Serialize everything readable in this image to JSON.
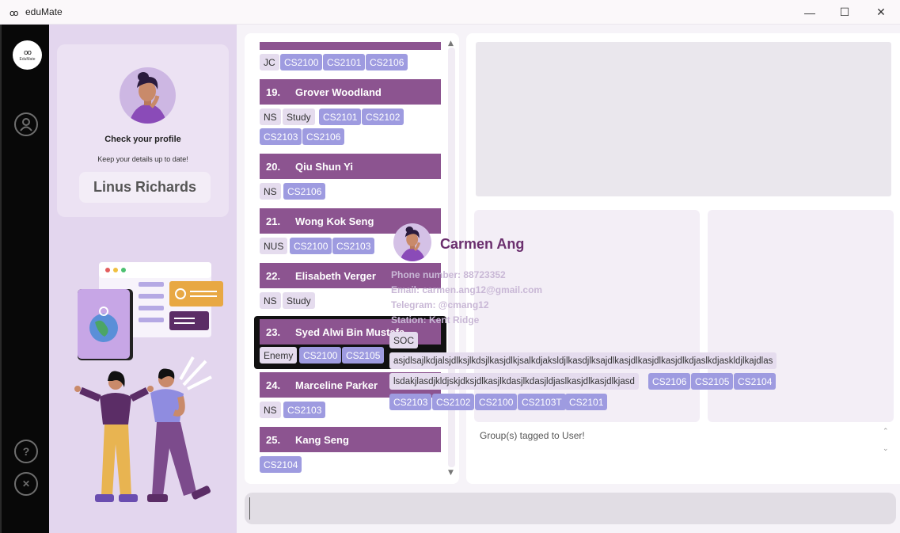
{
  "window": {
    "app_icon": "glasses-icon",
    "title": "eduMate",
    "minimize": "—",
    "maximize": "☐",
    "close": "✕"
  },
  "nav": {
    "logo_text": "EduMate",
    "help": "?",
    "exit": "✕"
  },
  "profile": {
    "heading": "Check your profile",
    "subheading": "Keep your details up to date!",
    "name": "Linus Richards"
  },
  "list": {
    "top_tags": [
      "JC",
      "CS2100",
      "CS2101",
      "CS2106"
    ],
    "people": [
      {
        "index": "19.",
        "name": "Grover Woodland",
        "tags": [
          "NS",
          "Study",
          "CS2101",
          "CS2102",
          "CS2103",
          "CS2106"
        ]
      },
      {
        "index": "20.",
        "name": "Qiu Shun Yi",
        "tags": [
          "NS",
          "CS2106"
        ]
      },
      {
        "index": "21.",
        "name": "Wong Kok Seng",
        "tags": [
          "NUS",
          "CS2100",
          "CS2103"
        ]
      },
      {
        "index": "22.",
        "name": "Elisabeth Verger",
        "tags": [
          "NS",
          "Study"
        ]
      },
      {
        "index": "23.",
        "name": "Syed Alwi Bin Mustafa",
        "tags": [
          "Enemy",
          "CS2100",
          "CS2105"
        ]
      },
      {
        "index": "24.",
        "name": "Marceline Parker",
        "tags": [
          "NS",
          "CS2103"
        ]
      },
      {
        "index": "25.",
        "name": "Kang Seng",
        "tags": [
          "CS2104"
        ]
      }
    ]
  },
  "detail": {
    "name": "Carmen Ang",
    "phone": "Phone number: 88723352",
    "email": "Email: carmen.ang12@gmail.com",
    "telegram": "Telegram: @cmang12",
    "station": "Station: Kent Ridge",
    "tags": {
      "soc": "SOC",
      "long1": "asjdlsajlkdjalsjdlksjlkdsjlkasjdlkjsalkdjaksldjlkasdjlksajdlkasjdlkasjdlkasjdlkdjaslkdjaskldjlkajdlas",
      "long2": "lsdakjlasdjkldjskjdksjdlkasjlkdasjlkdasjldjaslkasjdlkasjdlkjasd",
      "mods_row1": [
        "CS2106",
        "CS2105",
        "CS2104"
      ],
      "mods_row2": [
        "CS2103",
        "CS2102",
        "CS2100",
        "CS2103T",
        "CS2101"
      ]
    }
  },
  "groups_label": "Group(s) tagged to User!",
  "command": {
    "value": ""
  },
  "colors": {
    "header": "#8c5490",
    "module_tag": "#9e9be0",
    "plain_tag": "#e5dcee",
    "name": "#6b2f6e"
  }
}
